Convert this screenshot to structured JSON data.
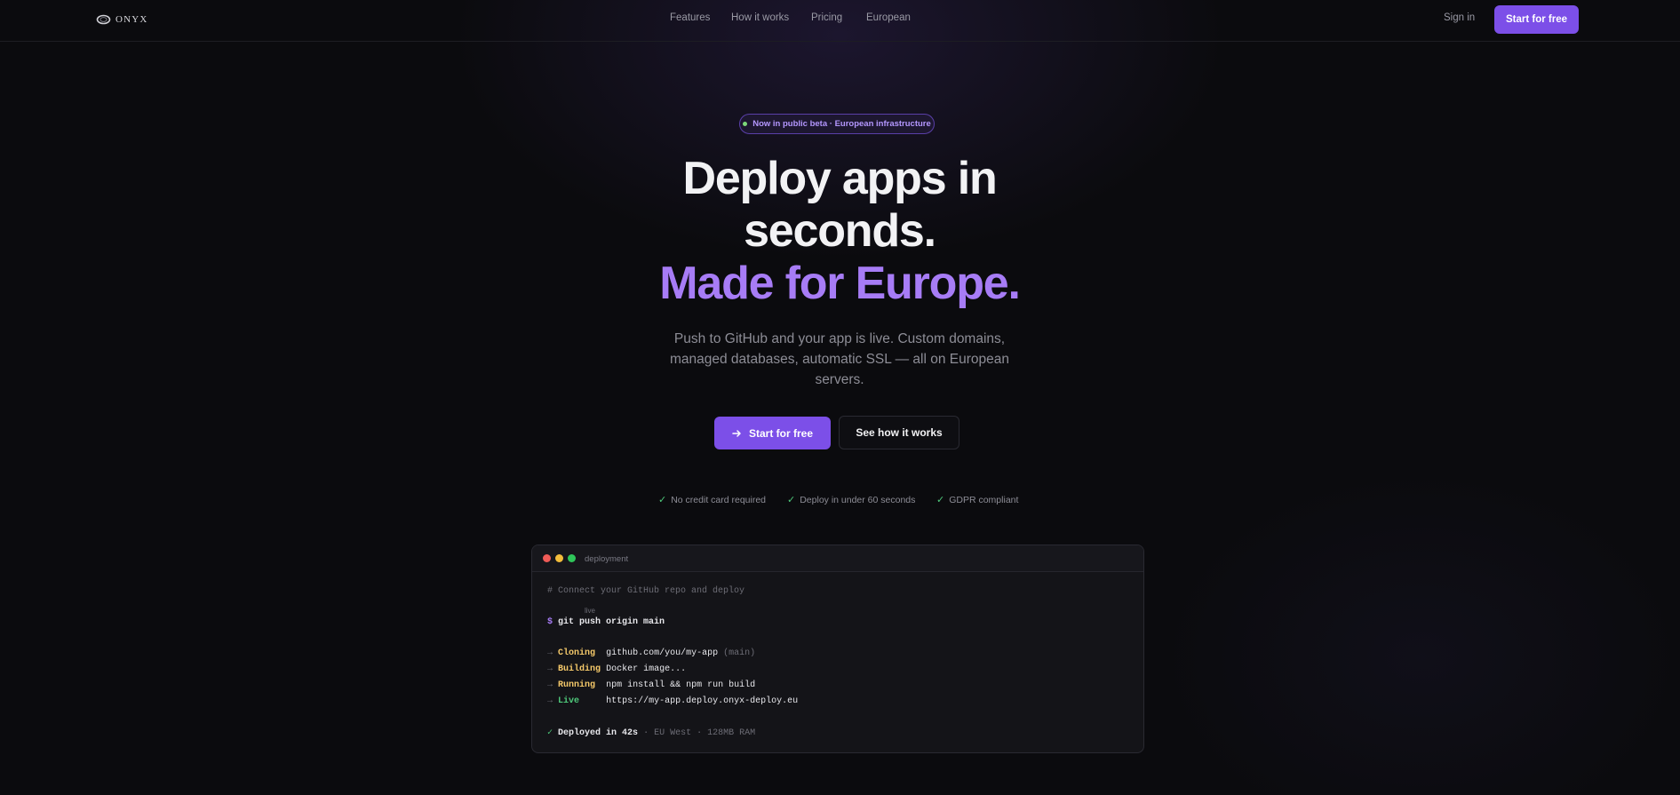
{
  "nav": {
    "logo_text": "ONYX",
    "links": [
      "Features",
      "How it works",
      "Pricing",
      "European"
    ],
    "sign_in": "Sign in",
    "cta": "Start for free"
  },
  "hero": {
    "badge": "Now in public beta · European infrastructure",
    "headline_line1": "Deploy apps in",
    "headline_line2": "seconds.",
    "headline_line3": "Made for Europe.",
    "subtitle": "Push to GitHub and your app is live. Custom domains, managed databases, automatic SSL — all on European servers.",
    "primary_button": "Start for free",
    "secondary_button": "See how it works",
    "checks": [
      "No credit card required",
      "Deploy in under 60 seconds",
      "GDPR compliant"
    ]
  },
  "terminal": {
    "title": "deployment",
    "tooltip": "live",
    "comment": "# Connect your GitHub repo and deploy",
    "prompt": "$",
    "command": "git push origin main",
    "steps": [
      {
        "label": "Cloning",
        "value": "github.com/you/my-app",
        "extra": "(main)"
      },
      {
        "label": "Building",
        "value": "Docker image...",
        "extra": ""
      },
      {
        "label": "Running",
        "value": "npm install && npm run build",
        "extra": ""
      },
      {
        "label": "Live",
        "value": "https://my-app.deploy.onyx-deploy.eu",
        "extra": ""
      }
    ],
    "done_check": "✓",
    "done_text": "Deployed in 42s",
    "done_meta": "· EU West · 128MB RAM"
  },
  "colors": {
    "accent": "#7c4fe8",
    "accent_text": "#a77cf6",
    "background": "#0b0b0e",
    "success": "#4ec97a"
  },
  "icons": {
    "logo": "onyx-ring-logo",
    "button_arrow": "arrow-right-icon",
    "check": "check-icon"
  }
}
